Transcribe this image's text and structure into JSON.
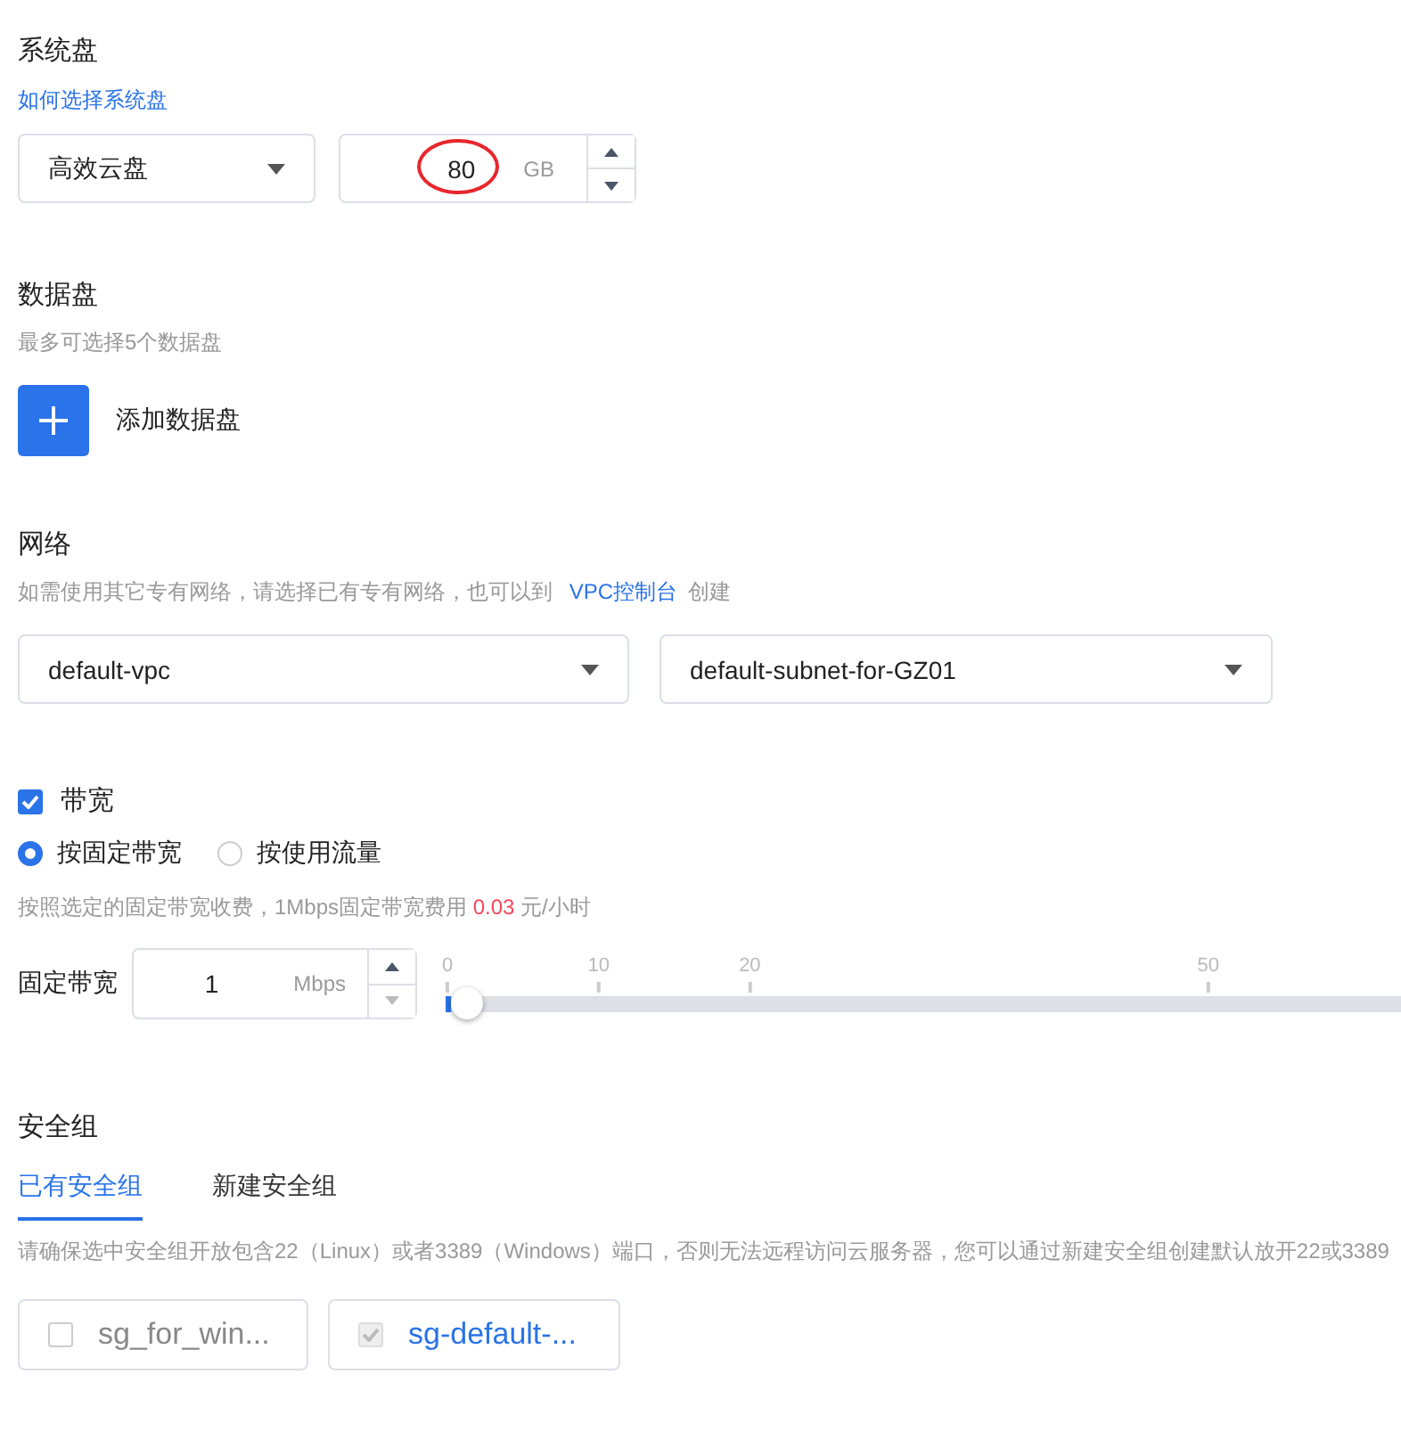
{
  "system_disk": {
    "title": "系统盘",
    "help_link": "如何选择系统盘",
    "type_select": {
      "value": "高效云盘"
    },
    "size": {
      "value": "80",
      "unit": "GB",
      "highlighted": true
    }
  },
  "data_disk": {
    "title": "数据盘",
    "hint": "最多可选择5个数据盘",
    "add_label": "添加数据盘"
  },
  "network": {
    "title": "网络",
    "hint": "如需使用其它专有网络，请选择已有专有网络，也可以到",
    "link": "VPC控制台",
    "hint_after": "创建",
    "selects": [
      {
        "value": "default-vpc"
      },
      {
        "value": "default-subnet-for-GZ01"
      }
    ]
  },
  "bandwidth": {
    "label": "带宽",
    "checked": true,
    "billing": [
      {
        "label": "按固定带宽",
        "selected": true
      },
      {
        "label": "按使用流量",
        "selected": false
      }
    ],
    "fee_note": {
      "before": "按照选定的固定带宽收费，1Mbps固定带宽费用",
      "price": "0.03",
      "after": "元/小时"
    },
    "fixed": {
      "label": "固定带宽",
      "value": "1",
      "unit": "Mbps",
      "down_disabled": true,
      "slider": {
        "level": 0.006,
        "ticks": [
          "0",
          "10",
          "20",
          "50"
        ]
      }
    }
  },
  "security_group": {
    "title": "安全组",
    "tabs": [
      {
        "label": "已有安全组",
        "selected": true
      },
      {
        "label": "新建安全组",
        "selected": false
      }
    ],
    "notice": "请确保选中安全组开放包含22（Linux）或者3389（Windows）端口，否则无法远程访问云服务器，您可以通过新建安全组创建默认放开22或3389",
    "groups": [
      {
        "name": "sg_for_win...",
        "checked": false,
        "disabled": false
      },
      {
        "name": "sg-default-...",
        "checked": true,
        "disabled": true
      }
    ]
  }
}
